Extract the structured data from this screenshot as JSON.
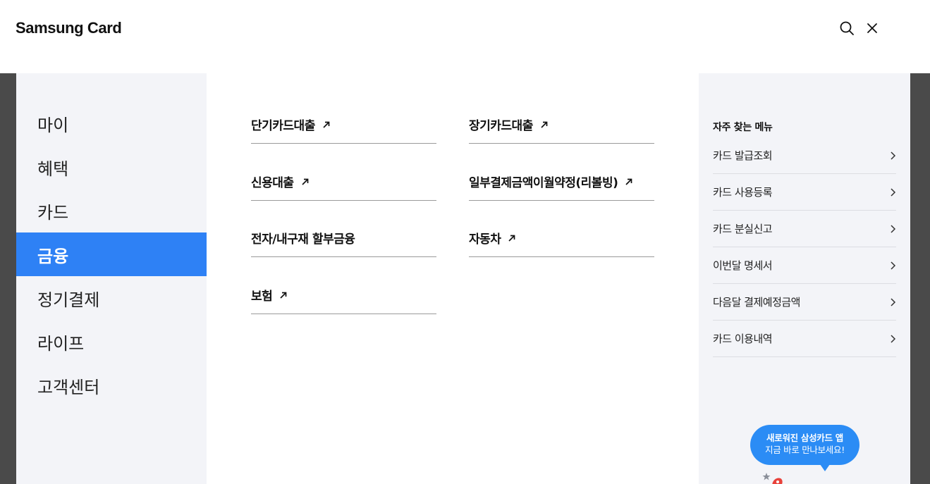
{
  "header": {
    "logo_text": "Samsung Card",
    "search_icon": "search-icon",
    "close_icon": "close-icon"
  },
  "left_nav": {
    "items": [
      {
        "label": "마이",
        "active": false
      },
      {
        "label": "혜택",
        "active": false
      },
      {
        "label": "카드",
        "active": false
      },
      {
        "label": "금융",
        "active": true
      },
      {
        "label": "정기결제",
        "active": false
      },
      {
        "label": "라이프",
        "active": false
      },
      {
        "label": "고객센터",
        "active": false
      }
    ]
  },
  "menu": {
    "left_column": [
      {
        "label": "단기카드대출",
        "external": true
      },
      {
        "label": "신용대출",
        "external": true
      },
      {
        "label": "전자/내구재 할부금융",
        "external": false
      },
      {
        "label": "보험",
        "external": true
      }
    ],
    "right_column": [
      {
        "label": "장기카드대출",
        "external": true
      },
      {
        "label": "일부결제금액이월약정(리볼빙)",
        "external": true
      },
      {
        "label": "자동차",
        "external": true
      }
    ]
  },
  "favorites": {
    "title": "자주 찾는 메뉴",
    "items": [
      {
        "label": "카드 발급조회"
      },
      {
        "label": "카드 사용등록"
      },
      {
        "label": "카드 분실신고"
      },
      {
        "label": "이번달 명세서"
      },
      {
        "label": "다음달 결제예정금액"
      },
      {
        "label": "카드 이용내역"
      }
    ]
  },
  "app_promo": {
    "line1": "새로워진 삼성카드 앱",
    "line2": "지금 바로 만나보세요!"
  },
  "colors": {
    "accent": "#2e81f5",
    "bubble": "#2b8cf5",
    "nav_bg": "#f3f4f8",
    "backdrop": "#4a4a4a"
  }
}
